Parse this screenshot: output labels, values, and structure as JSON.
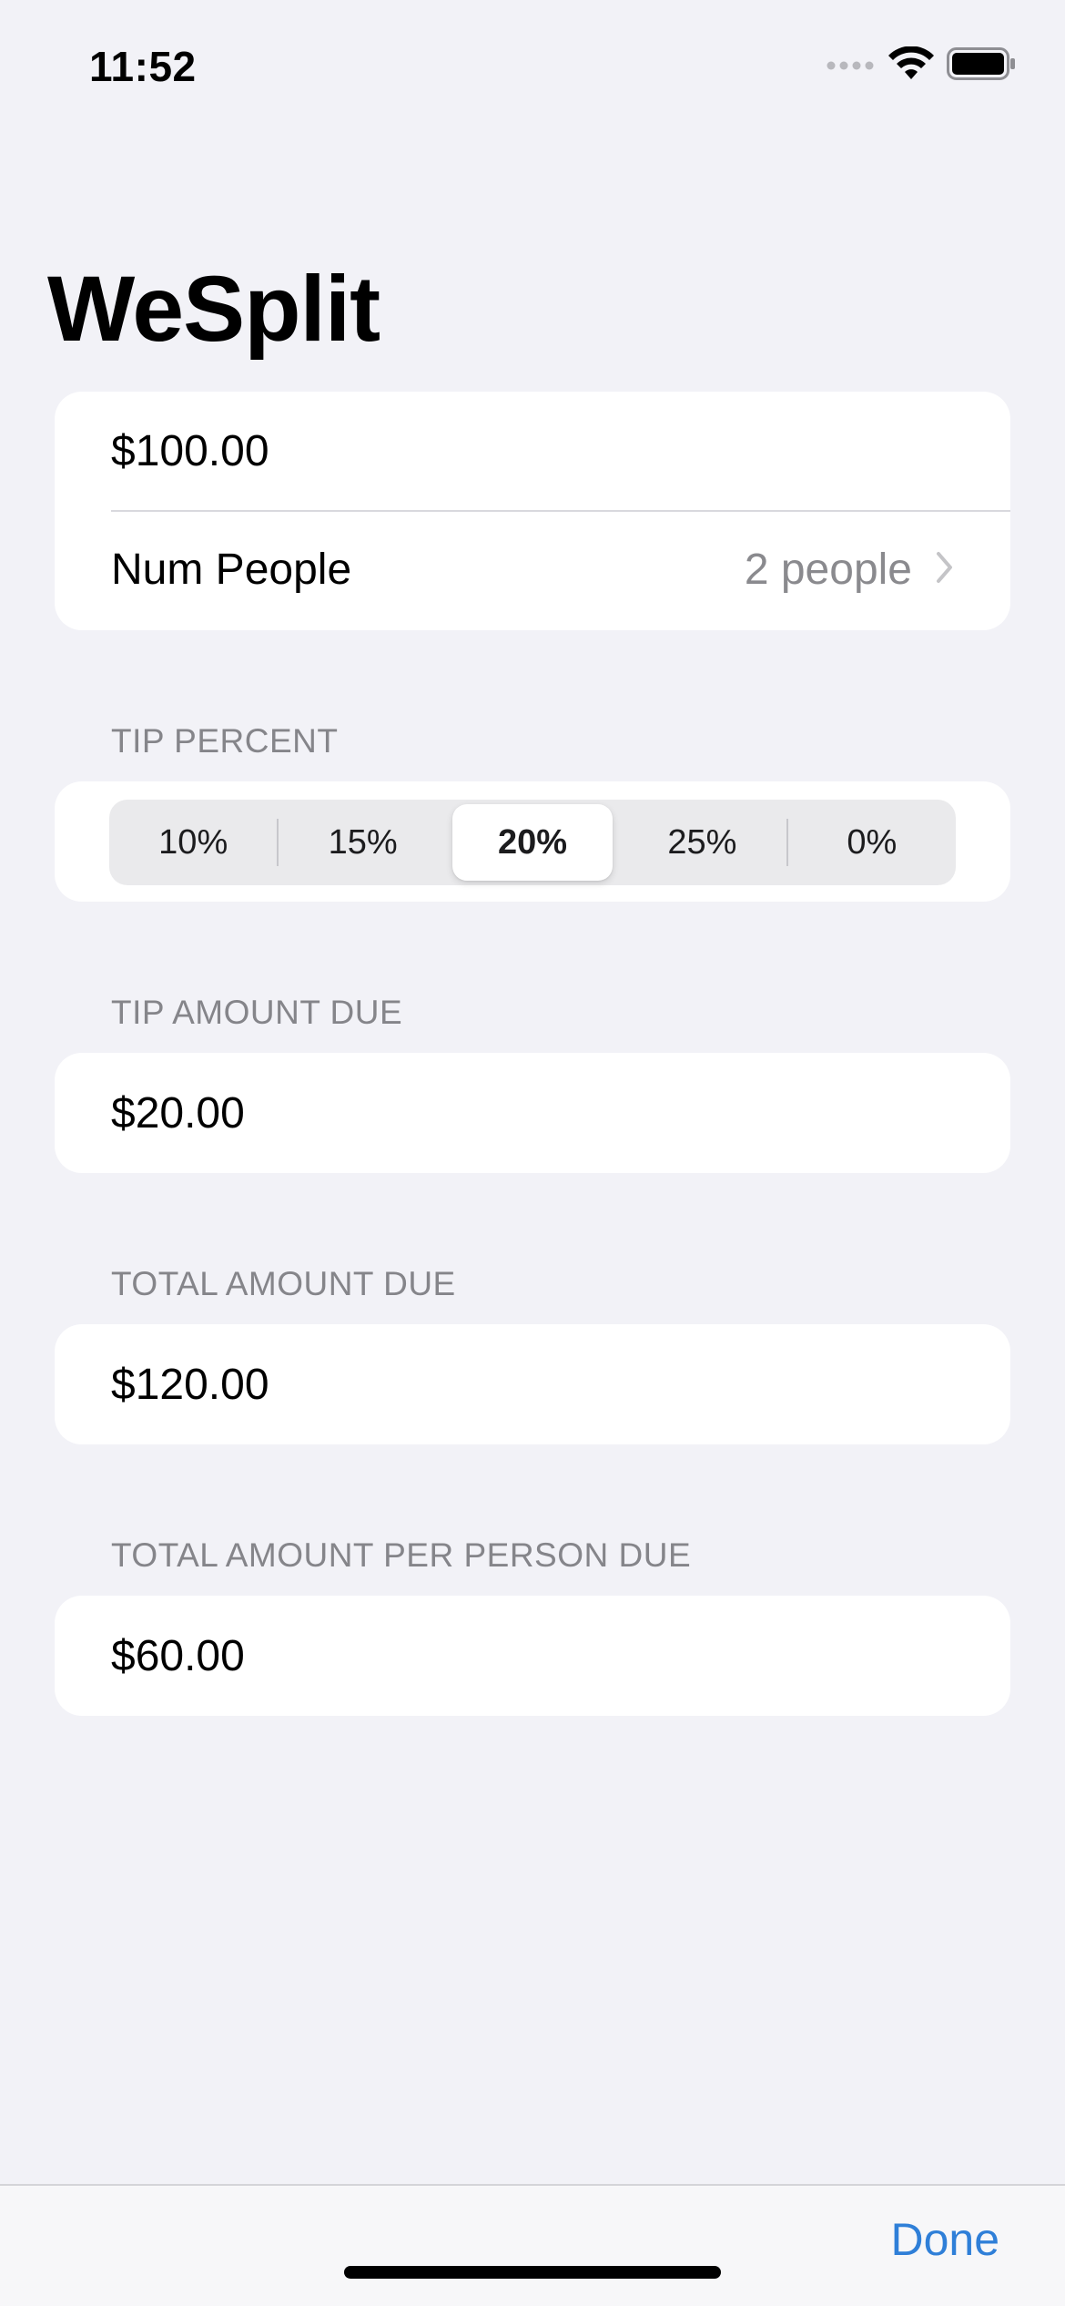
{
  "status_bar": {
    "time": "11:52",
    "signal_icon": "cellular-signal-icon",
    "wifi_icon": "wifi-icon",
    "battery_icon": "battery-icon"
  },
  "nav": {
    "title": "WeSplit"
  },
  "input_section": {
    "amount_value": "$100.00",
    "num_people_label": "Num People",
    "num_people_value": "2 people",
    "chevron_icon": "chevron-right-icon"
  },
  "tip_section": {
    "header": "TIP PERCENT",
    "options": [
      "10%",
      "15%",
      "20%",
      "25%",
      "0%"
    ],
    "selected": "20%"
  },
  "tip_amount_section": {
    "header": "TIP AMOUNT DUE",
    "value": "$20.00"
  },
  "total_section": {
    "header": "TOTAL AMOUNT DUE",
    "value": "$120.00"
  },
  "per_person_section": {
    "header": "TOTAL AMOUNT PER PERSON DUE",
    "value": "$60.00"
  },
  "keyboard_toolbar": {
    "done_label": "Done"
  },
  "colors": {
    "background": "#f2f2f7",
    "card": "#ffffff",
    "accent": "#2f7fd8",
    "secondary_text": "#8a8a8e"
  }
}
